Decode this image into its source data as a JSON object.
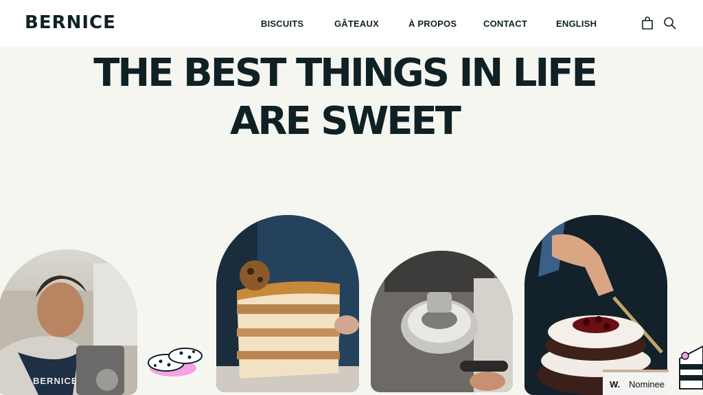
{
  "header": {
    "logo": "BERNICE",
    "nav": [
      "BISCUITS",
      "GÂTEAUX",
      "À PROPOS",
      "CONTACT",
      "ENGLISH"
    ]
  },
  "icons": [
    "shopping-bag-icon",
    "search-icon"
  ],
  "hero": {
    "line1": "THE BEST THINGS IN LIFE",
    "line2": "ARE SWEET"
  },
  "badge": {
    "mark": "W.",
    "label": "Nominee"
  },
  "apron_text": "BERNICE",
  "colors": {
    "background": "#f6f6f1",
    "header": "#ffffff",
    "text": "#102125",
    "cookie_shadow": "#f5a3e3"
  }
}
